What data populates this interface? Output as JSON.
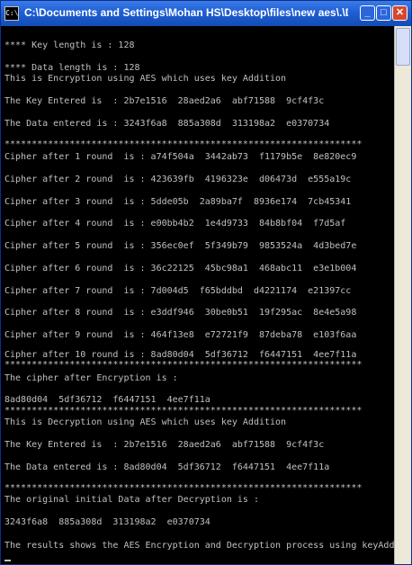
{
  "window": {
    "title": "C:\\Documents and Settings\\Mohan HS\\Desktop\\files\\new aes\\.\\Debug\\aes.exe",
    "minimize_label": "_",
    "maximize_label": "□",
    "close_label": "✕",
    "icon": "console-icon",
    "icon_text": "C:\\"
  },
  "console_lines": [
    "**** Key length is : 128",
    "**** Data length is : 128",
    "This is Encryption using AES which uses key Addition",
    "The Key Entered is  : 2b7e1516  28aed2a6  abf71588  9cf4f3c",
    "The Data entered is : 3243f6a8  885a308d  313198a2  e0370734",
    "******************************************************************",
    "Cipher after 1 round  is : a74f504a  3442ab73  f1179b5e  8e820ec9",
    "Cipher after 2 round  is : 423639fb  4196323e  d06473d  e555a19c",
    "Cipher after 3 round  is : 5dde05b  2a89ba7f  8936e174  7cb45341",
    "Cipher after 4 round  is : e00bb4b2  1e4d9733  84b8bf04  f7d5af",
    "Cipher after 5 round  is : 356ec0ef  5f349b79  9853524a  4d3bed7e",
    "Cipher after 6 round  is : 36c22125  45bc98a1  468abc11  e3e1b004",
    "Cipher after 7 round  is : 7d004d5  f65bddbd  d4221174  e21397cc",
    "Cipher after 8 round  is : e3ddf946  30be0b51  19f295ac  8e4e5a98",
    "Cipher after 9 round  is : 464f13e8  e72721f9  87deba78  e103f6aa",
    "Cipher after 10 round is : 8ad80d04  5df36712  f6447151  4ee7f11a",
    "******************************************************************",
    "The cipher after Encryption is :",
    "8ad80d04  5df36712  f6447151  4ee7f11a",
    "******************************************************************",
    "This is Decryption using AES which uses key Addition",
    "The Key Entered is  : 2b7e1516  28aed2a6  abf71588  9cf4f3c",
    "The Data entered is : 8ad80d04  5df36712  f6447151  4ee7f11a",
    "******************************************************************",
    "The original initial Data after Decryption is :",
    "3243f6a8  885a308d  313198a2  e0370734",
    "The results shows the AES Encryption and Decryption process using keyAddition"
  ]
}
